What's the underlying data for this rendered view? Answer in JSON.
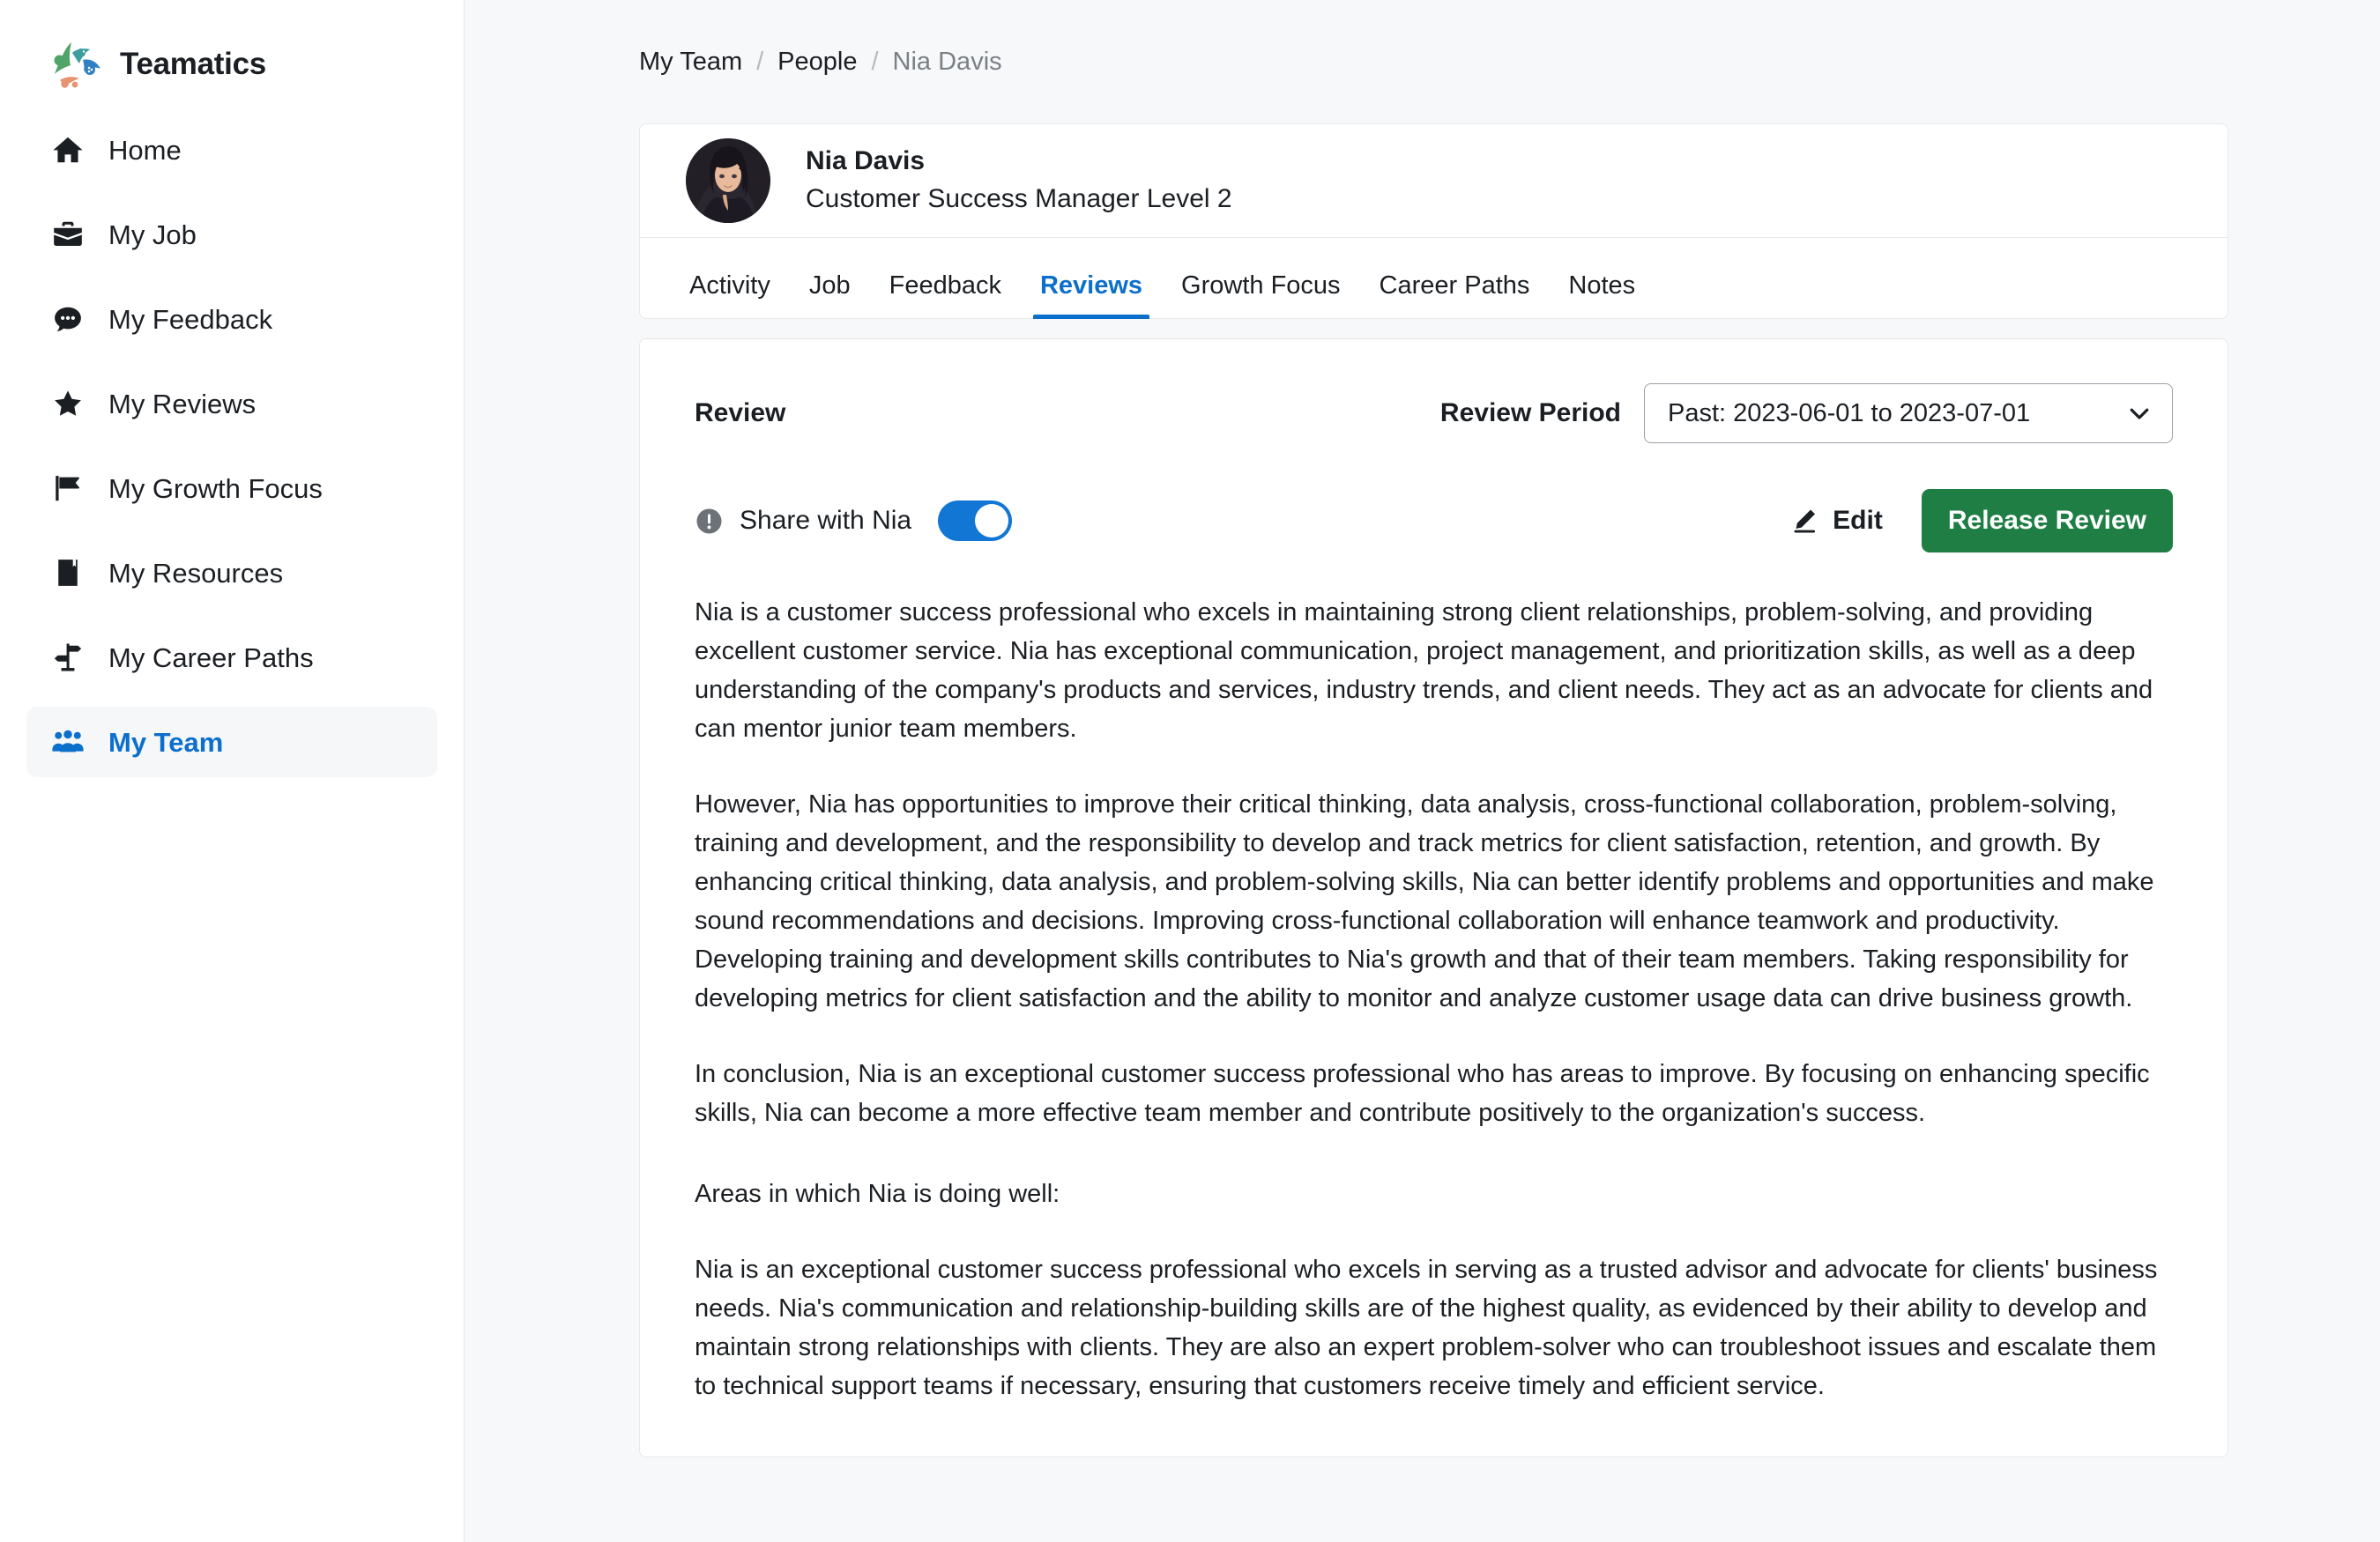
{
  "brand": {
    "name": "Teamatics",
    "logo_colors": {
      "green": "#4FA46A",
      "teal": "#3E9E9E",
      "blue": "#2F7FC4",
      "orange": "#E59370"
    }
  },
  "sidebar": {
    "items": [
      {
        "label": "Home",
        "icon": "home-icon",
        "active": false
      },
      {
        "label": "My Job",
        "icon": "briefcase-icon",
        "active": false
      },
      {
        "label": "My Feedback",
        "icon": "comment-dots-icon",
        "active": false
      },
      {
        "label": "My Reviews",
        "icon": "star-icon",
        "active": false
      },
      {
        "label": "My Growth Focus",
        "icon": "flag-icon",
        "active": false
      },
      {
        "label": "My Resources",
        "icon": "book-icon",
        "active": false
      },
      {
        "label": "My Career Paths",
        "icon": "signpost-icon",
        "active": false
      },
      {
        "label": "My Team",
        "icon": "people-group-icon",
        "active": true
      }
    ],
    "active_color": "#0B6FCB",
    "active_background": "#F5F7F9"
  },
  "breadcrumb": {
    "items": [
      "My Team",
      "People",
      "Nia Davis"
    ],
    "separator": "/"
  },
  "profile": {
    "name": "Nia Davis",
    "title": "Customer Success Manager Level 2",
    "avatar": "nia-davis-photo"
  },
  "tabs": [
    {
      "label": "Activity",
      "active": false
    },
    {
      "label": "Job",
      "active": false
    },
    {
      "label": "Feedback",
      "active": false
    },
    {
      "label": "Reviews",
      "active": true
    },
    {
      "label": "Growth Focus",
      "active": false
    },
    {
      "label": "Career Paths",
      "active": false
    },
    {
      "label": "Notes",
      "active": false
    }
  ],
  "review": {
    "section_title": "Review",
    "period_label": "Review Period",
    "period_value": "Past: 2023-06-01 to 2023-07-01",
    "share_label": "Share with Nia",
    "share_enabled": true,
    "edit_label": "Edit",
    "release_label": "Release Review",
    "release_color": "#1E7E44",
    "toggle_color": "#1277D4",
    "paragraphs": [
      "Nia is a customer success professional who excels in maintaining strong client relationships, problem-solving, and providing excellent customer service. Nia has exceptional communication, project management, and prioritization skills, as well as a deep understanding of the company's products and services, industry trends, and client needs. They act as an advocate for clients and can mentor junior team members.",
      "However, Nia has opportunities to improve their critical thinking, data analysis, cross-functional collaboration, problem-solving, training and development, and the responsibility to develop and track metrics for client satisfaction, retention, and growth. By enhancing critical thinking, data analysis, and problem-solving skills, Nia can better identify problems and opportunities and make sound recommendations and decisions. Improving cross-functional collaboration will enhance teamwork and productivity. Developing training and development skills contributes to Nia's growth and that of their team members. Taking responsibility for developing metrics for client satisfaction and the ability to monitor and analyze customer usage data can drive business growth.",
      "In conclusion, Nia is an exceptional customer success professional who has areas to improve. By focusing on enhancing specific skills, Nia can become a more effective team member and contribute positively to the organization's success.",
      "Areas in which Nia is doing well:",
      "Nia is an exceptional customer success professional who excels in serving as a trusted advisor and advocate for clients' business needs. Nia's communication and relationship-building skills are of the highest quality, as evidenced by their ability to develop and maintain strong relationships with clients. They are also an expert problem-solver who can troubleshoot issues and escalate them to technical support teams if necessary, ensuring that customers receive timely and efficient service."
    ]
  }
}
